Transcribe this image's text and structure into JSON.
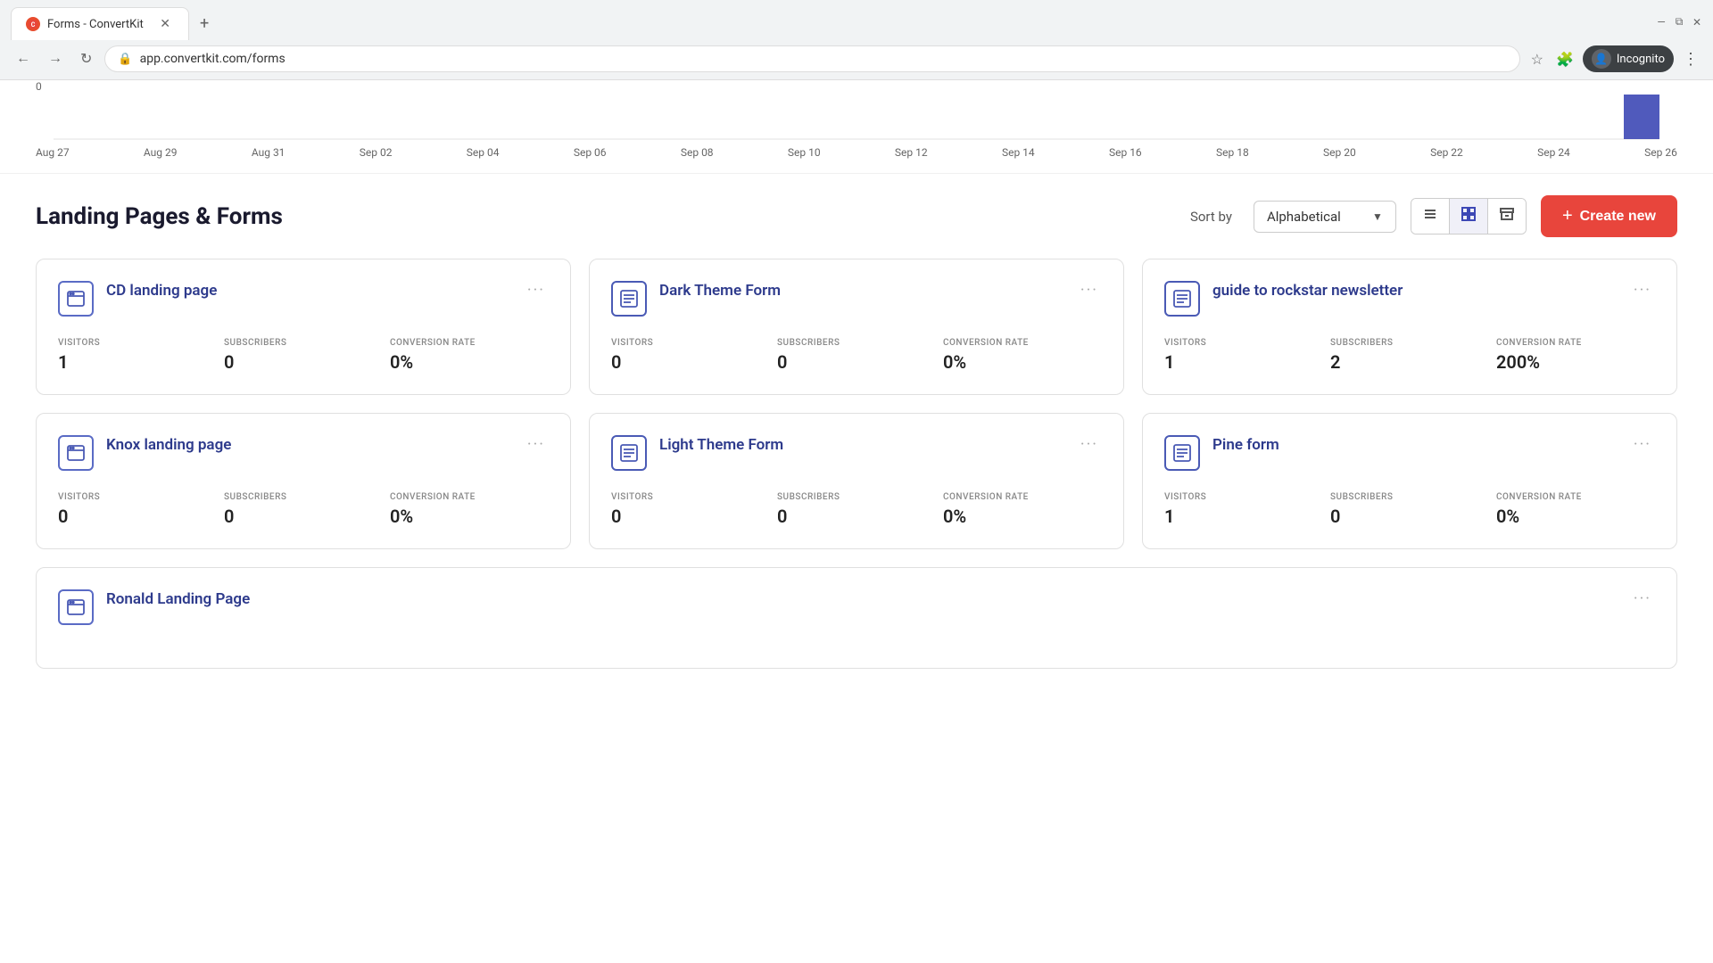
{
  "browser": {
    "tab_title": "Forms - ConvertKit",
    "tab_favicon": "F",
    "url": "app.convertkit.com/forms",
    "incognito_label": "Incognito"
  },
  "chart": {
    "y_zero": "0",
    "dates": [
      "Aug 27",
      "Aug 29",
      "Aug 31",
      "Sep 02",
      "Sep 04",
      "Sep 06",
      "Sep 08",
      "Sep 10",
      "Sep 12",
      "Sep 14",
      "Sep 16",
      "Sep 18",
      "Sep 20",
      "Sep 22",
      "Sep 24",
      "Sep 26"
    ]
  },
  "header": {
    "title": "Landing Pages & Forms",
    "sort_label": "Sort by",
    "sort_value": "Alphabetical",
    "create_label": "Create new"
  },
  "cards": [
    {
      "id": "cd-landing-page",
      "title": "CD landing page",
      "type": "landing",
      "visitors": "1",
      "subscribers": "0",
      "conversion_rate": "0%"
    },
    {
      "id": "dark-theme-form",
      "title": "Dark Theme Form",
      "type": "form",
      "visitors": "0",
      "subscribers": "0",
      "conversion_rate": "0%"
    },
    {
      "id": "guide-to-rockstar",
      "title": "guide to rockstar newsletter",
      "type": "form",
      "visitors": "1",
      "subscribers": "2",
      "conversion_rate": "200%"
    },
    {
      "id": "knox-landing-page",
      "title": "Knox landing page",
      "type": "landing",
      "visitors": "0",
      "subscribers": "0",
      "conversion_rate": "0%"
    },
    {
      "id": "light-theme-form",
      "title": "Light Theme Form",
      "type": "form",
      "visitors": "0",
      "subscribers": "0",
      "conversion_rate": "0%"
    },
    {
      "id": "pine-form",
      "title": "Pine form",
      "type": "form",
      "visitors": "1",
      "subscribers": "0",
      "conversion_rate": "0%"
    }
  ],
  "bottom_card": {
    "title": "Ronald Landing Page",
    "type": "landing"
  },
  "labels": {
    "visitors": "VISITORS",
    "subscribers": "SUBSCRIBERS",
    "conversion_rate": "CONVERSION RATE"
  }
}
